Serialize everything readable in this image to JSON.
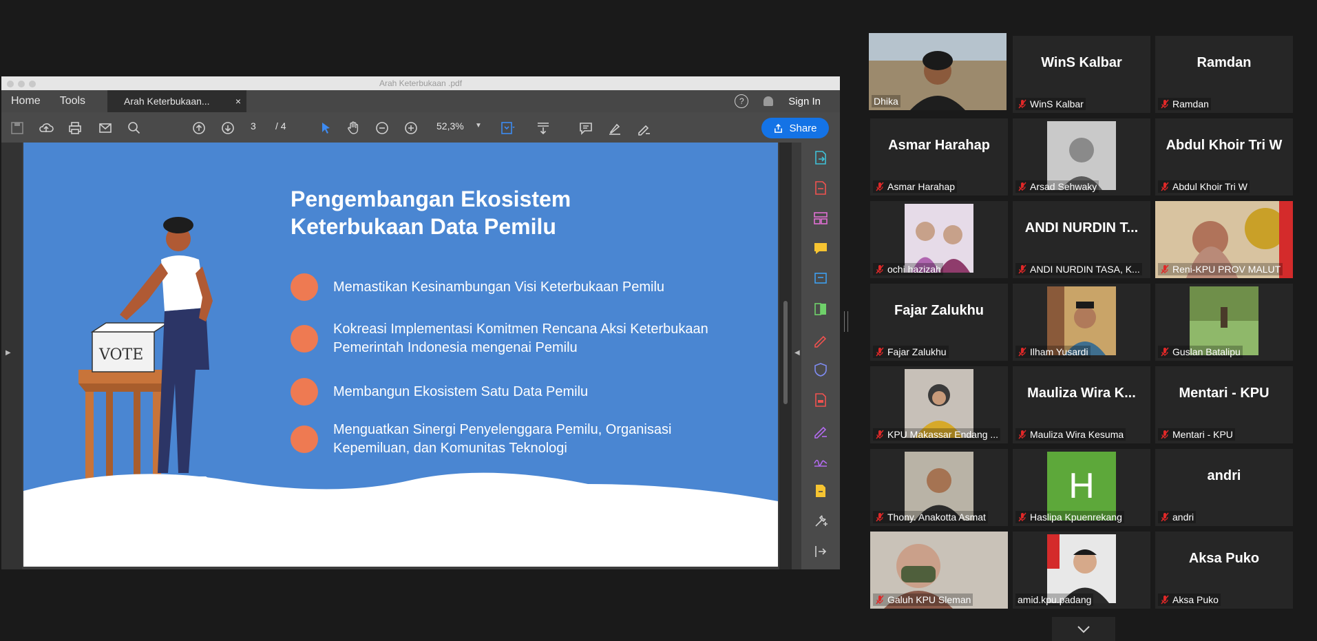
{
  "pdf": {
    "window_title": "Arah Keterbukaan .pdf",
    "nav": {
      "home": "Home",
      "tools": "Tools"
    },
    "doc_tab": "Arah Keterbukaan...",
    "close_tab": "×",
    "help": "?",
    "sign_in": "Sign In",
    "page_current": "3",
    "page_total": "/ 4",
    "zoom": "52,3%",
    "share": "Share"
  },
  "slide": {
    "title_line1": "Pengembangan Ekosistem",
    "title_line2": "Keterbukaan Data Pemilu",
    "vote_label": "VOTE",
    "bullets": [
      "Memastikan Kesinambungan Visi Keterbukaan Pemilu",
      "Kokreasi Implementasi Komitmen Rencana Aksi Keterbukaan Pemerintah Indonesia mengenai Pemilu",
      "Membangun Ekosistem Satu Data Pemilu",
      "Menguatkan Sinergi Penyelenggara Pemilu, Organisasi Kepemiluan, dan Komunitas Teknologi"
    ],
    "colors": {
      "background": "#4a86d2",
      "bullet": "#ee7a52"
    }
  },
  "participants": [
    {
      "name": "Dhika",
      "big": "",
      "video": true,
      "active": true,
      "muted": false
    },
    {
      "name": "WinS Kalbar",
      "big": "WinS Kalbar",
      "video": false,
      "muted": true
    },
    {
      "name": "Ramdan",
      "big": "Ramdan",
      "video": false,
      "muted": true
    },
    {
      "name": "Asmar Harahap",
      "big": "Asmar Harahap",
      "video": false,
      "muted": true
    },
    {
      "name": "Arsad Sehwaky",
      "big": "",
      "video": true,
      "muted": true
    },
    {
      "name": "Abdul Khoir Tri W",
      "big": "Abdul Khoir Tri W",
      "video": false,
      "muted": true
    },
    {
      "name": "ochi hazizah",
      "big": "",
      "video": true,
      "muted": true
    },
    {
      "name": "ANDI NURDIN TASA, K...",
      "big": "ANDI NURDIN T...",
      "video": false,
      "muted": true
    },
    {
      "name": "Reni-KPU PROV MALUT",
      "big": "",
      "video": true,
      "muted": true
    },
    {
      "name": "Fajar Zalukhu",
      "big": "Fajar Zalukhu",
      "video": false,
      "muted": true
    },
    {
      "name": "Ilham Yusardi",
      "big": "",
      "video": true,
      "muted": true
    },
    {
      "name": "Guslan Batalipu",
      "big": "",
      "video": true,
      "muted": true
    },
    {
      "name": "KPU Makassar Endang ...",
      "big": "",
      "video": true,
      "muted": true
    },
    {
      "name": "Mauliza Wira Kesuma",
      "big": "Mauliza Wira K...",
      "video": false,
      "muted": true
    },
    {
      "name": "Mentari - KPU",
      "big": "Mentari - KPU",
      "video": false,
      "muted": true
    },
    {
      "name": "Thony. Anakotta Asmat",
      "big": "",
      "video": true,
      "muted": true
    },
    {
      "name": "Haslipa Kpuenrekang",
      "big": "H",
      "video": false,
      "avatar": true,
      "muted": true
    },
    {
      "name": "andri",
      "big": "andri",
      "video": false,
      "muted": true
    },
    {
      "name": "Galuh KPU Sleman",
      "big": "",
      "video": true,
      "muted": true
    },
    {
      "name": "amid.kpu.padang",
      "big": "",
      "video": true,
      "muted": false
    },
    {
      "name": "Aksa Puko",
      "big": "Aksa Puko",
      "video": false,
      "muted": true
    }
  ]
}
